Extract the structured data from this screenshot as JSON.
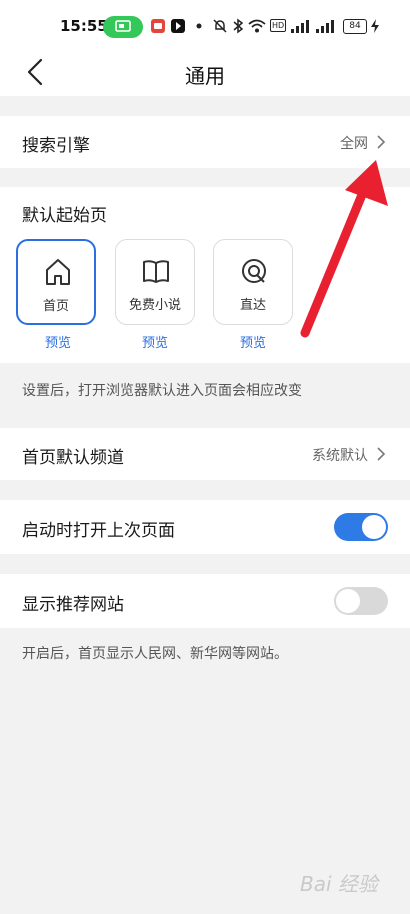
{
  "status_bar": {
    "time": "15:55",
    "battery": "84",
    "hd_badge": "HD"
  },
  "header": {
    "title": "通用"
  },
  "search_engine": {
    "label": "搜索引擎",
    "value": "全网"
  },
  "start_page": {
    "label": "默认起始页",
    "tiles": [
      {
        "label": "首页",
        "preview": "预览",
        "selected": true
      },
      {
        "label": "免费小说",
        "preview": "预览",
        "selected": false
      },
      {
        "label": "直达",
        "preview": "预览",
        "selected": false
      }
    ],
    "note": "设置后，打开浏览器默认进入页面会相应改变"
  },
  "home_channel": {
    "label": "首页默认频道",
    "value": "系统默认"
  },
  "restore_last": {
    "label": "启动时打开上次页面",
    "enabled": true
  },
  "recommended_sites": {
    "label": "显示推荐网站",
    "enabled": false,
    "note": "开启后，首页显示人民网、新华网等网站。"
  },
  "colors": {
    "accent": "#2a6fe0",
    "toggle_on": "#2f7be6",
    "annotation_arrow": "#e8202f"
  },
  "watermark": "Bai 经验"
}
